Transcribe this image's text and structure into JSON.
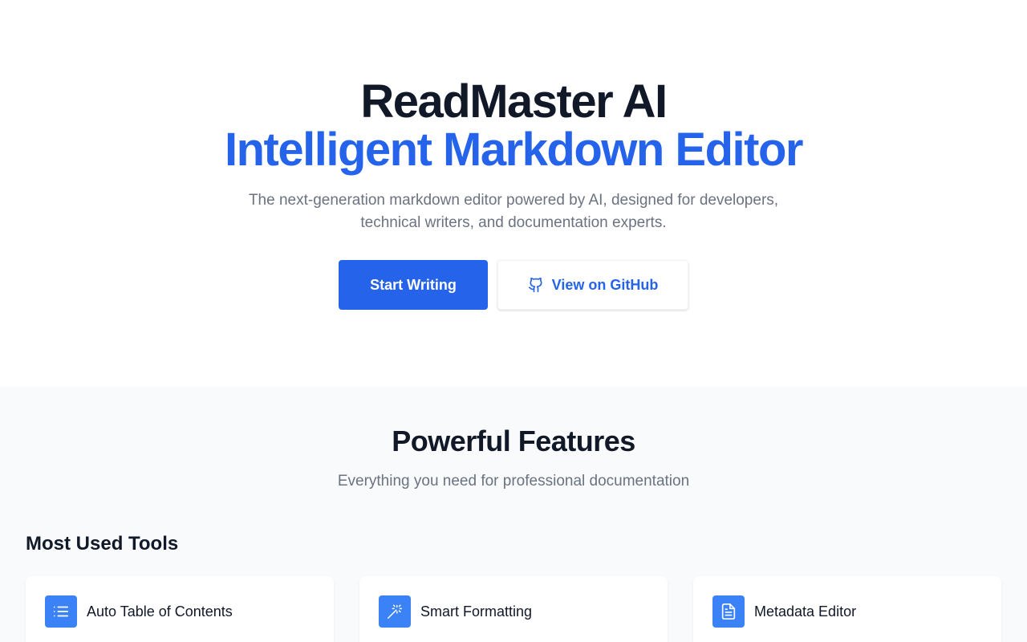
{
  "hero": {
    "title": "ReadMaster AI",
    "subtitle": "Intelligent Markdown Editor",
    "description": "The next-generation markdown editor powered by AI, designed for developers, technical writers, and documentation experts.",
    "primary_button": "Start Writing",
    "secondary_button": "View on GitHub",
    "secondary_button_icon": "github-icon"
  },
  "features": {
    "title": "Powerful Features",
    "description": "Everything you need for professional documentation",
    "section_heading": "Most Used Tools",
    "cards": [
      {
        "title": "Auto Table of Contents",
        "icon": "list-icon"
      },
      {
        "title": "Smart Formatting",
        "icon": "magic-wand-icon"
      },
      {
        "title": "Metadata Editor",
        "icon": "document-icon"
      }
    ]
  },
  "colors": {
    "accent": "#2563eb",
    "icon_background": "#3b82f6",
    "heading": "#111827",
    "muted_text": "#6b7280",
    "features_background": "#f8fafc"
  }
}
